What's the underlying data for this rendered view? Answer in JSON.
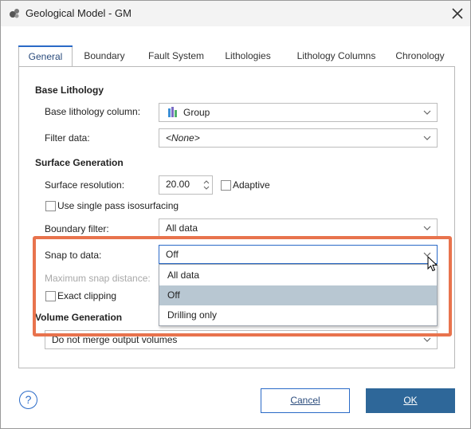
{
  "window": {
    "title": "Geological Model - GM"
  },
  "icons": {
    "app": "geological-model-icon",
    "close": "close-icon",
    "chevron": "chevron-down-icon",
    "lithology_group": "lithology-group-icon",
    "help": "help-icon",
    "cursor": "mouse-pointer-icon"
  },
  "tabs": [
    {
      "label": "General",
      "active": true
    },
    {
      "label": "Boundary",
      "active": false
    },
    {
      "label": "Fault System",
      "active": false
    },
    {
      "label": "Lithologies",
      "active": false
    },
    {
      "label": "Lithology Columns",
      "active": false
    },
    {
      "label": "Chronology",
      "active": false
    }
  ],
  "base_lithology": {
    "title": "Base Lithology",
    "column_label": "Base lithology column:",
    "column_value": "Group",
    "filter_label": "Filter data:",
    "filter_value": "<None>"
  },
  "surface_generation": {
    "title": "Surface Generation",
    "resolution_label": "Surface resolution:",
    "resolution_value": "20.00",
    "adaptive_label": "Adaptive",
    "adaptive_checked": false,
    "single_pass_label": "Use single pass isosurfacing",
    "single_pass_checked": false,
    "boundary_filter_label": "Boundary filter:",
    "boundary_filter_value": "All data",
    "snap_label": "Snap to data:",
    "snap_value": "Off",
    "max_snap_label": "Maximum snap distance:",
    "exact_clipping_label": "Exact clipping",
    "exact_clipping_checked": false
  },
  "snap_dropdown": {
    "options": [
      "All data",
      "Off",
      "Drilling only"
    ],
    "selected": "Off"
  },
  "volume_generation": {
    "title": "Volume Generation",
    "value": "Do not merge output volumes"
  },
  "footer": {
    "help_label": "?",
    "cancel_label": "Cancel",
    "ok_label": "OK"
  },
  "colors": {
    "accent": "#2a6ac7",
    "ok_button": "#2e6799",
    "highlight_border": "#e8734d",
    "dropdown_selected": "#b8c7d2"
  }
}
